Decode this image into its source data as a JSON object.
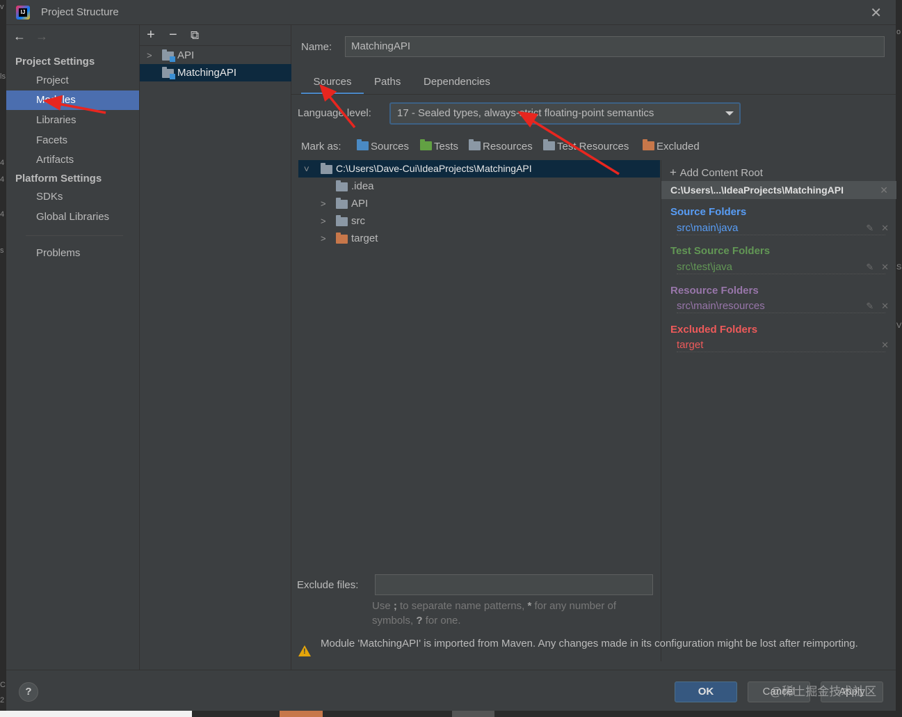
{
  "window": {
    "title": "Project Structure",
    "close": "✕"
  },
  "edge_left": [
    "v",
    "ls",
    "4",
    "4",
    "4",
    "s",
    "C",
    "2"
  ],
  "edge_right": [
    "o",
    "S",
    "V"
  ],
  "sidebar": {
    "project_settings_header": "Project Settings",
    "project_items": [
      "Project",
      "Modules",
      "Libraries",
      "Facets",
      "Artifacts"
    ],
    "platform_settings_header": "Platform Settings",
    "platform_items": [
      "SDKs",
      "Global Libraries"
    ],
    "problems": "Problems",
    "selected": "Modules"
  },
  "modules_toolbar": {
    "add": "+",
    "remove": "−",
    "copy": "⧉"
  },
  "modules": [
    {
      "name": "API",
      "expandable": true,
      "selected": false
    },
    {
      "name": "MatchingAPI",
      "expandable": false,
      "selected": true
    }
  ],
  "content": {
    "name_label": "Name:",
    "name_value": "MatchingAPI",
    "tabs": [
      "Sources",
      "Paths",
      "Dependencies"
    ],
    "active_tab": "Sources",
    "language_level_label": "Language level:",
    "language_level_value": "17 - Sealed types, always-strict floating-point semantics",
    "mark_as_label": "Mark as:",
    "mark_as": [
      "Sources",
      "Tests",
      "Resources",
      "Test Resources",
      "Excluded"
    ],
    "tree": [
      {
        "name": "C:\\Users\\Dave-Cui\\IdeaProjects\\MatchingAPI",
        "expanded": true,
        "selected": true
      },
      {
        "name": ".idea"
      },
      {
        "name": "API"
      },
      {
        "name": "src"
      },
      {
        "name": "target"
      }
    ],
    "exclude_files_label": "Exclude files:",
    "exclude_files_value": "",
    "hint_part1": "Use ",
    "hint_sep": ";",
    "hint_part2": " to separate name patterns, ",
    "hint_star": "*",
    "hint_part3": " for any number of symbols, ",
    "hint_q": "?",
    "hint_part4": " for one.",
    "warning": "Module 'MatchingAPI' is imported from Maven. Any changes made in its configuration might be lost after reimporting."
  },
  "roots": {
    "add_content_root": "Add Content Root",
    "root_path": "C:\\Users\\...\\IdeaProjects\\MatchingAPI",
    "source_folders_title": "Source Folders",
    "source_folders_path": "src\\main\\java",
    "test_source_folders_title": "Test Source Folders",
    "test_source_folders_path": "src\\test\\java",
    "resource_folders_title": "Resource Folders",
    "resource_folders_path": "src\\main\\resources",
    "excluded_folders_title": "Excluded Folders",
    "excluded_folders_path": "target"
  },
  "footer": {
    "help": "?",
    "ok": "OK",
    "cancel": "Cancel",
    "apply": "Apply",
    "watermark": "@稀土掘金技术社区"
  },
  "colors": {
    "accent": "#4b6eaf",
    "tree_selection": "#0d293e",
    "source": "#589df6",
    "test": "#629755",
    "resource": "#9876aa",
    "excluded": "#ee5a5a",
    "annotation_arrow": "#e8261f"
  }
}
